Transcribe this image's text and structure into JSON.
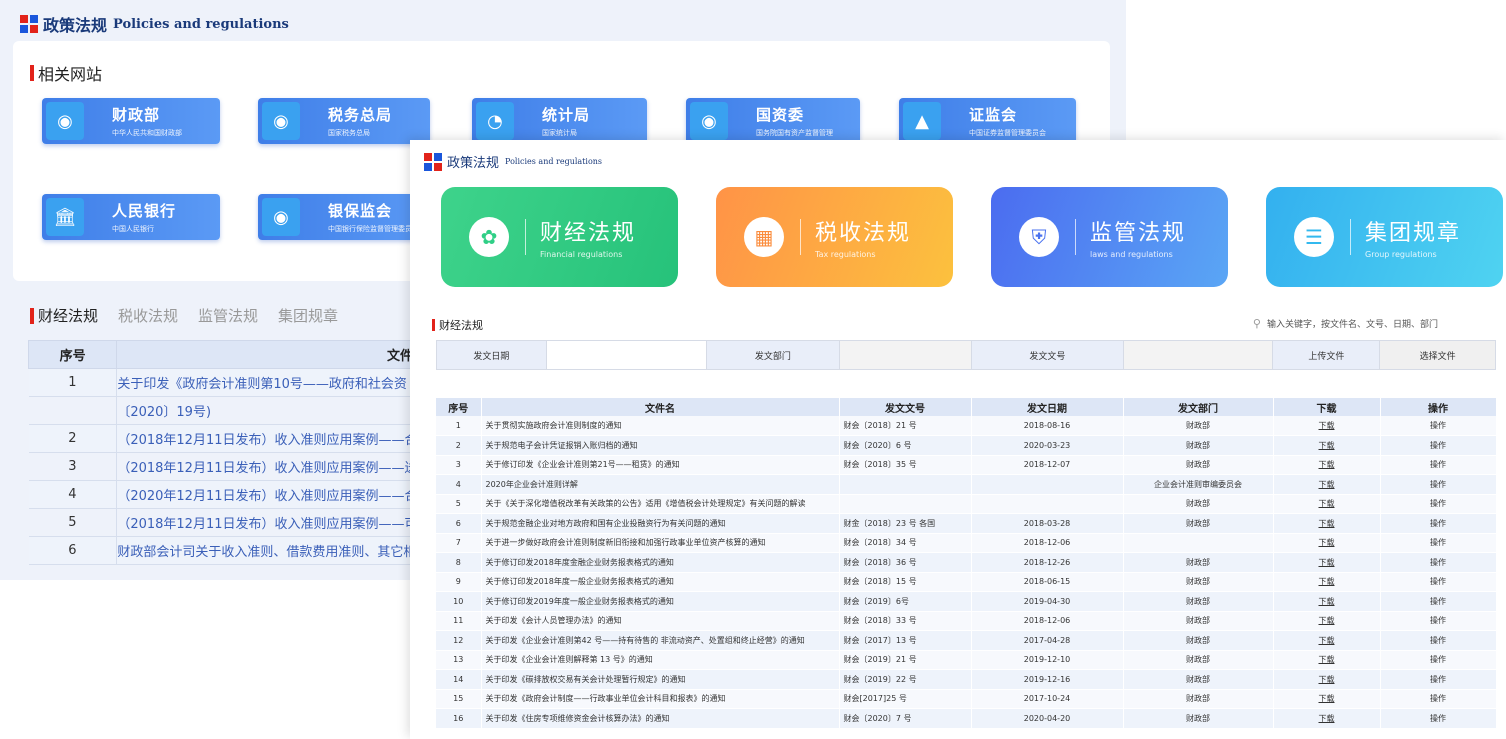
{
  "back": {
    "header_zh": "政策法规",
    "header_en": "Policies and regulations",
    "related_title": "相关网站",
    "sites": [
      {
        "name": "财政部",
        "sub": "中华人民共和国财政部",
        "icon": "emblem-icon"
      },
      {
        "name": "税务总局",
        "sub": "国家税务总局",
        "icon": "emblem-icon"
      },
      {
        "name": "统计局",
        "sub": "国家统计局",
        "icon": "chart-icon"
      },
      {
        "name": "国资委",
        "sub": "国务院国有资产监督管理",
        "icon": "emblem-icon"
      },
      {
        "name": "证监会",
        "sub": "中国证券监督管理委员会",
        "icon": "triangle-logo-icon"
      },
      {
        "name": "人民银行",
        "sub": "中国人民银行",
        "icon": "bank-icon"
      },
      {
        "name": "银保监会",
        "sub": "中国银行保险监督管理委员会",
        "icon": "emblem-icon"
      }
    ],
    "tabs": [
      "财经法规",
      "税收法规",
      "监管法规",
      "集团规章"
    ],
    "table_headers": [
      "序号",
      "文件"
    ],
    "rows": [
      {
        "no": "1",
        "title": "关于印发《政府会计准则第10号——政府和社会资"
      },
      {
        "no": "",
        "title": "〔2020〕19号)"
      },
      {
        "no": "2",
        "title": "（2018年12月11日发布）收入准则应用案例——合"
      },
      {
        "no": "3",
        "title": "（2018年12月11日发布）收入准则应用案例——送"
      },
      {
        "no": "4",
        "title": "（2020年12月11日发布）收入准则应用案例——合"
      },
      {
        "no": "5",
        "title": "（2018年12月11日发布）收入准则应用案例——可"
      },
      {
        "no": "6",
        "title": "财政部会计司关于收入准则、借款费用准则、其它相"
      }
    ]
  },
  "front": {
    "header_zh": "政策法规",
    "header_en": "Policies and regulations",
    "cards": [
      {
        "name": "财经法规",
        "sub": "Financial regulations",
        "icon": "leaf-icon",
        "color": "#2fcf86"
      },
      {
        "name": "税收法规",
        "sub": "Tax regulations",
        "icon": "tax-icon",
        "color": "#fb8c3c"
      },
      {
        "name": "监管法规",
        "sub": "laws and regulations",
        "icon": "shield-icon",
        "color": "#4a72ef"
      },
      {
        "name": "集团规章",
        "sub": "Group regulations",
        "icon": "document-icon",
        "color": "#33b9ef"
      }
    ],
    "sub_title": "财经法规",
    "search_placeholder": "输入关键字，按文件名、文号、日期、部门",
    "filter": {
      "date_label": "发文日期",
      "dept_label": "发文部门",
      "docno_label": "发文文号",
      "upload_label": "上传文件",
      "choose_label": "选择文件"
    },
    "table_headers": [
      "序号",
      "文件名",
      "发文文号",
      "发文日期",
      "发文部门",
      "下载",
      "操作"
    ],
    "download_label": "下载",
    "action_label": "操作",
    "rows": [
      {
        "no": "1",
        "name": "关于贯彻实施政府会计准则制度的通知",
        "docno": "财会〔2018〕21 号",
        "date": "2018-08-16",
        "dept": "财政部"
      },
      {
        "no": "2",
        "name": "关于规范电子会计凭证报销入账归档的通知",
        "docno": "财会〔2020〕6 号",
        "date": "2020-03-23",
        "dept": "财政部"
      },
      {
        "no": "3",
        "name": "关于修订印发《企业会计准则第21号——租赁》的通知",
        "docno": "财会〔2018〕35 号",
        "date": "2018-12-07",
        "dept": "财政部"
      },
      {
        "no": "4",
        "name": "2020年企业会计准则详解",
        "docno": "",
        "date": "",
        "dept": "企业会计准则审编委员会"
      },
      {
        "no": "5",
        "name": "关于《关于深化增值税改革有关政策的公告》适用《增值税会计处理规定》有关问题的解读",
        "docno": "",
        "date": "",
        "dept": "财政部"
      },
      {
        "no": "6",
        "name": "关于规范金融企业对地方政府和国有企业投融资行为有关问题的通知",
        "docno": "财金〔2018〕23 号 各国",
        "date": "2018-03-28",
        "dept": "财政部"
      },
      {
        "no": "7",
        "name": "关于进一步做好政府会计准则制度新旧衔接和加强行政事业单位资产核算的通知",
        "docno": "财会〔2018〕34 号",
        "date": "2018-12-06",
        "dept": ""
      },
      {
        "no": "8",
        "name": "关于修订印发2018年度金融企业财务报表格式的通知",
        "docno": "财会〔2018〕36 号",
        "date": "2018-12-26",
        "dept": "财政部"
      },
      {
        "no": "9",
        "name": "关于修订印发2018年度一般企业财务报表格式的通知",
        "docno": "财会〔2018〕15 号",
        "date": "2018-06-15",
        "dept": "财政部"
      },
      {
        "no": "10",
        "name": "关于修订印发2019年度一般企业财务报表格式的通知",
        "docno": "财会〔2019〕6号",
        "date": "2019-04-30",
        "dept": "财政部"
      },
      {
        "no": "11",
        "name": "关于印发《会计人员管理办法》的通知",
        "docno": "财会〔2018〕33 号",
        "date": "2018-12-06",
        "dept": "财政部"
      },
      {
        "no": "12",
        "name": "关于印发《企业会计准则第42 号——持有待售的 非流动资产、处置组和终止经营》的通知",
        "docno": "财会〔2017〕13 号",
        "date": "2017-04-28",
        "dept": "财政部"
      },
      {
        "no": "13",
        "name": "关于印发《企业会计准则解释第 13 号》的通知",
        "docno": "财会〔2019〕21 号",
        "date": "2019-12-10",
        "dept": "财政部"
      },
      {
        "no": "14",
        "name": "关于印发《碳排放权交易有关会计处理暂行规定》的通知",
        "docno": "财会〔2019〕22 号",
        "date": "2019-12-16",
        "dept": "财政部"
      },
      {
        "no": "15",
        "name": "关于印发《政府会计制度——行政事业单位会计科目和报表》的通知",
        "docno": "财会[2017]25 号",
        "date": "2017-10-24",
        "dept": "财政部"
      },
      {
        "no": "16",
        "name": "关于印发《住房专项维修资金会计核算办法》的通知",
        "docno": "财会〔2020〕7 号",
        "date": "2020-04-20",
        "dept": "财政部"
      }
    ]
  }
}
